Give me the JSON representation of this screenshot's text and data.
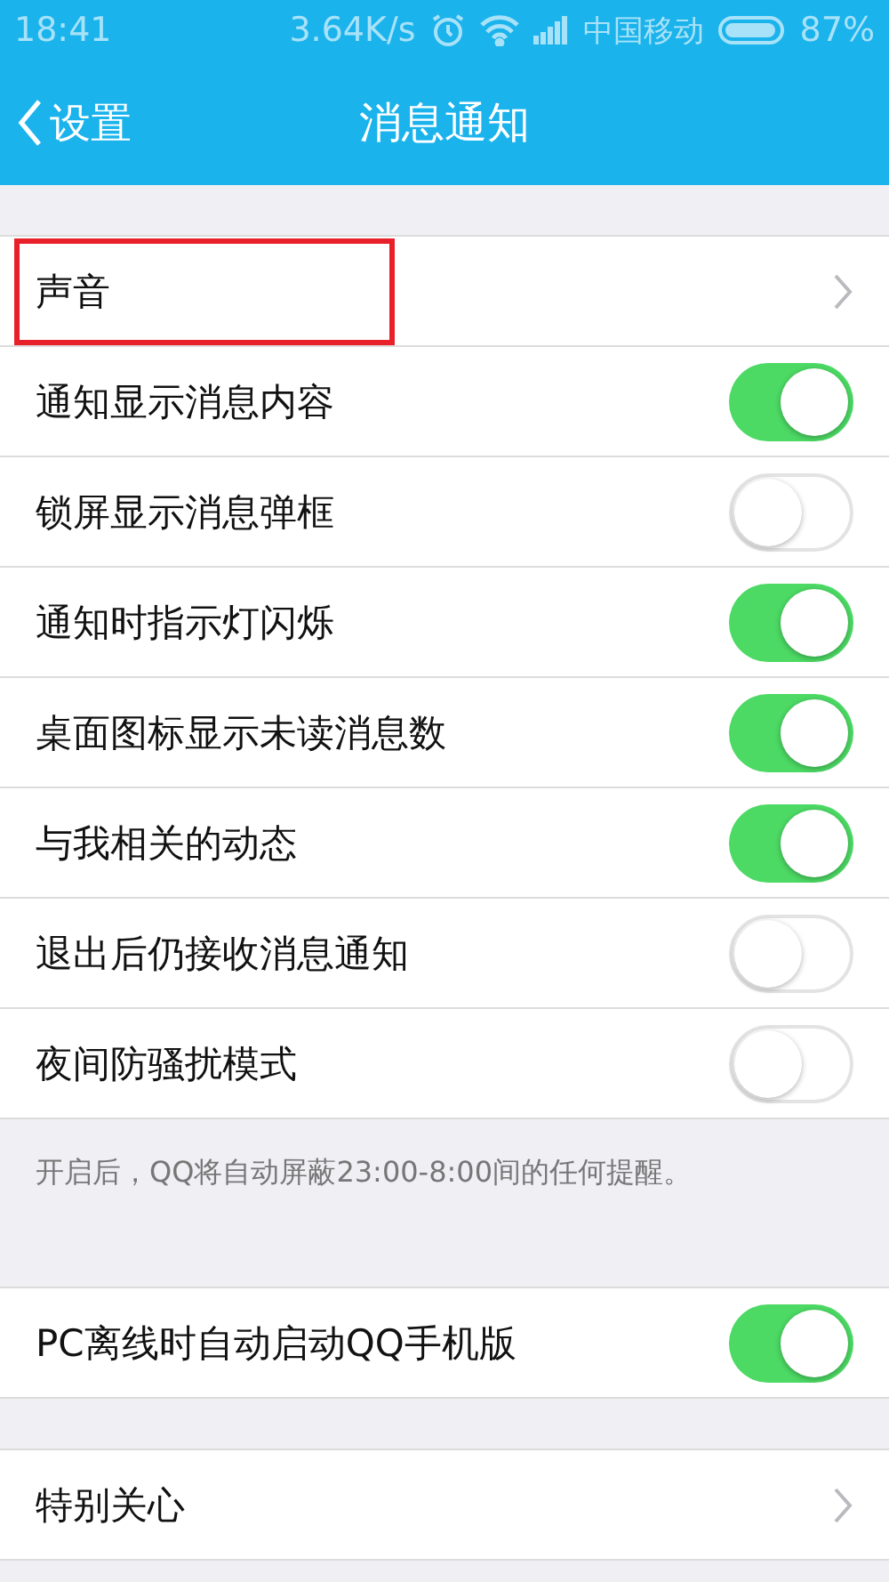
{
  "status_bar": {
    "time": "18:41",
    "speed": "3.64K/s",
    "carrier": "中国移动",
    "battery": "87%"
  },
  "nav": {
    "back": "设置",
    "title": "消息通知"
  },
  "groups": [
    {
      "rows": [
        {
          "kind": "link",
          "label": "声音",
          "highlighted": true
        },
        {
          "kind": "toggle",
          "label": "通知显示消息内容",
          "on": true,
          "highlighted": false
        },
        {
          "kind": "toggle",
          "label": "锁屏显示消息弹框",
          "on": false,
          "highlighted": false
        },
        {
          "kind": "toggle",
          "label": "通知时指示灯闪烁",
          "on": true,
          "highlighted": false
        },
        {
          "kind": "toggle",
          "label": "桌面图标显示未读消息数",
          "on": true,
          "highlighted": false
        },
        {
          "kind": "toggle",
          "label": "与我相关的动态",
          "on": true,
          "highlighted": false
        },
        {
          "kind": "toggle",
          "label": "退出后仍接收消息通知",
          "on": false,
          "highlighted": false
        },
        {
          "kind": "toggle",
          "label": "夜间防骚扰模式",
          "on": false,
          "highlighted": false
        }
      ],
      "note": "开启后，QQ将自动屏蔽23:00-8:00间的任何提醒。"
    },
    {
      "rows": [
        {
          "kind": "toggle",
          "label": "PC离线时自动启动QQ手机版",
          "on": true,
          "highlighted": false
        }
      ]
    },
    {
      "rows": [
        {
          "kind": "link",
          "label": "特别关心",
          "highlighted": false
        }
      ]
    }
  ]
}
